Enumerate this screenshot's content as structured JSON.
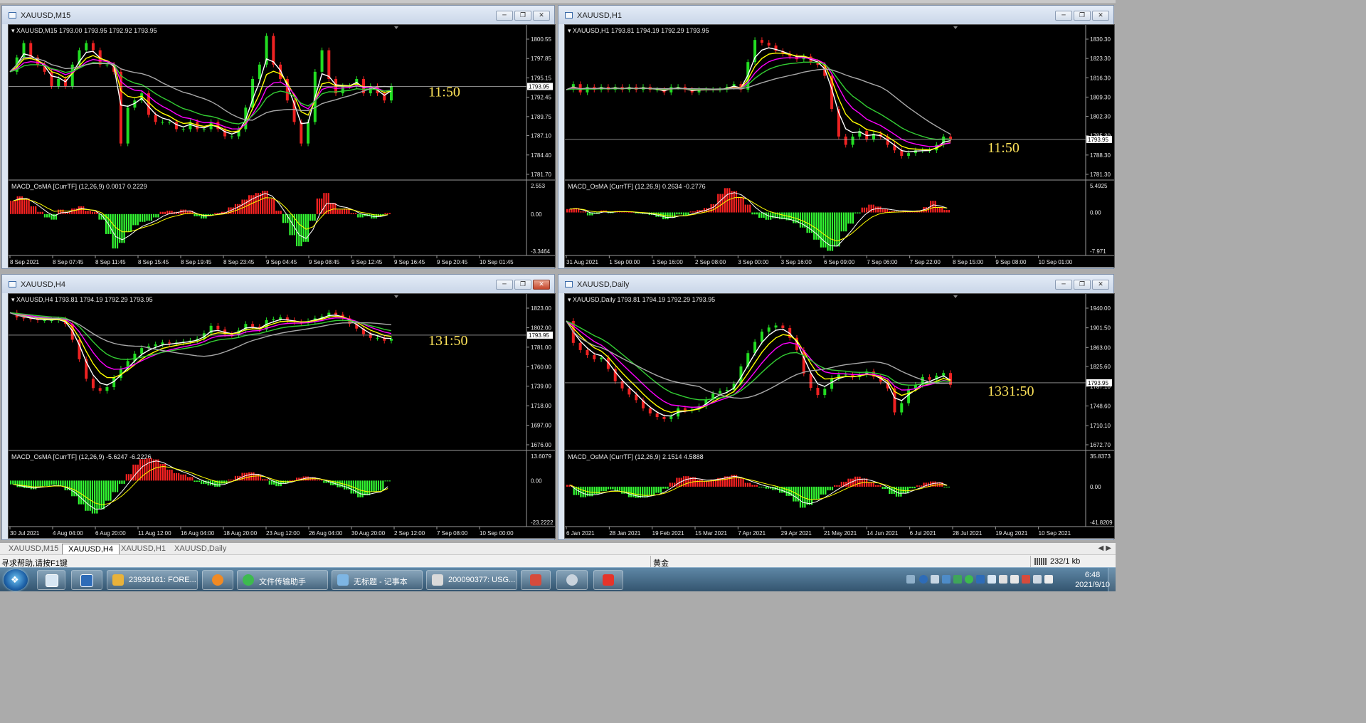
{
  "colors": {
    "price_line": "#D8D8D8",
    "ma_white": "#FFFFFF",
    "ma_yellow": "#FFFF00",
    "ma_magenta": "#FF00FF",
    "ma_green": "#33CC33",
    "ma_gray": "#A8A8A8",
    "hist_up": "#FF2222",
    "hist_down": "#33FF33",
    "timer": "#FFE45A",
    "text": "#E8E8E8"
  },
  "charts": [
    {
      "window_title": "XAUUSD,M15",
      "info": "XAUUSD,M15  1793.00 1793.95 1792.92 1793.95",
      "price_ticks": [
        "1800.55",
        "1797.85",
        "1795.15",
        "1792.45",
        "1789.75",
        "1787.10",
        "1784.40",
        "1781.70"
      ],
      "current_price": "1793.95",
      "timer": "11:50",
      "macd_label": "MACD_OsMA [CurrTF] (12,26,9) 0.0017 0.2229",
      "macd_ticks": [
        "2.553",
        "0.00",
        "-3.3464"
      ],
      "time_labels": [
        "8 Sep 2021",
        "8 Sep 07:45",
        "8 Sep 11:45",
        "8 Sep 15:45",
        "8 Sep 19:45",
        "8 Sep 23:45",
        "9 Sep 04:45",
        "9 Sep 08:45",
        "9 Sep 12:45",
        "9 Sep 16:45",
        "9 Sep 20:45",
        "10 Sep 01:45"
      ],
      "close_red": false
    },
    {
      "window_title": "XAUUSD,H1",
      "info": "XAUUSD,H1  1793.81 1794.19 1792.29 1793.95",
      "price_ticks": [
        "1830.30",
        "1823.30",
        "1816.30",
        "1809.30",
        "1802.30",
        "1795.30",
        "1788.30",
        "1781.30"
      ],
      "current_price": "1793.95",
      "timer": "11:50",
      "macd_label": "MACD_OsMA [CurrTF] (12,26,9) 0.2634 -0.2776",
      "macd_ticks": [
        "5.4925",
        "0.00",
        "-7.971"
      ],
      "time_labels": [
        "31 Aug 2021",
        "1 Sep 00:00",
        "1 Sep 16:00",
        "2 Sep 08:00",
        "3 Sep 00:00",
        "3 Sep 16:00",
        "6 Sep 09:00",
        "7 Sep 06:00",
        "7 Sep 22:00",
        "8 Sep 15:00",
        "9 Sep 08:00",
        "10 Sep 01:00"
      ],
      "close_red": false
    },
    {
      "window_title": "XAUUSD,H4",
      "info": "XAUUSD,H4  1793.81 1794.19 1792.29 1793.95",
      "price_ticks": [
        "1823.00",
        "1802.00",
        "1781.00",
        "1760.00",
        "1739.00",
        "1718.00",
        "1697.00",
        "1676.00"
      ],
      "current_price": "1793.95",
      "timer": "131:50",
      "macd_label": "MACD_OsMA [CurrTF] (12,26,9) -5.6247 -6.2226",
      "macd_ticks": [
        "13.6079",
        "0.00",
        "-23.2222"
      ],
      "time_labels": [
        "30 Jul 2021",
        "4 Aug 04:00",
        "6 Aug 20:00",
        "11 Aug 12:00",
        "16 Aug 04:00",
        "18 Aug 20:00",
        "23 Aug 12:00",
        "26 Aug 04:00",
        "30 Aug 20:00",
        "2 Sep 12:00",
        "7 Sep 08:00",
        "10 Sep 00:00"
      ],
      "close_red": true
    },
    {
      "window_title": "XAUUSD,Daily",
      "info": "XAUUSD,Daily  1793.81 1794.19 1792.29 1793.95",
      "price_ticks": [
        "1940.00",
        "1901.50",
        "1863.00",
        "1825.60",
        "1787.10",
        "1748.60",
        "1710.10",
        "1672.70"
      ],
      "current_price": "1793.95",
      "timer": "1331:50",
      "macd_label": "MACD_OsMA [CurrTF] (12,26,9) 2.1514 4.5888",
      "macd_ticks": [
        "35.8373",
        "0.00",
        "-41.8209"
      ],
      "time_labels": [
        "6 Jan 2021",
        "28 Jan 2021",
        "19 Feb 2021",
        "15 Mar 2021",
        "7 Apr 2021",
        "29 Apr 2021",
        "21 May 2021",
        "14 Jun 2021",
        "6 Jul 2021",
        "28 Jul 2021",
        "19 Aug 2021",
        "10 Sep 2021"
      ],
      "close_red": false
    }
  ],
  "chart_series": [
    {
      "price": [
        1796,
        1798,
        1800,
        1798,
        1797,
        1796,
        1794,
        1795,
        1794,
        1797,
        1799,
        1800,
        1799,
        1797,
        1797,
        1796,
        1786,
        1791,
        1792,
        1793,
        1790,
        1789,
        1789,
        1789,
        1788,
        1788,
        1789,
        1788,
        1788,
        1789,
        1788,
        1787,
        1787,
        1788,
        1791,
        1795,
        1797,
        1801,
        1797,
        1795,
        1792,
        1789,
        1786,
        1789,
        1796,
        1799,
        1795,
        1793,
        1794,
        1794,
        1795,
        1793,
        1794,
        1793,
        1792,
        1794
      ],
      "macd": [
        1.2,
        1.6,
        1.4,
        0.7,
        0.2,
        -0.3,
        -0.5,
        0.4,
        0.2,
        0.5,
        0.7,
        0.3,
        0.2,
        -0.5,
        -1.8,
        -3.1,
        -2.6,
        -1.6,
        -1.0,
        -0.7,
        -0.6,
        -0.3,
        0.2,
        0.3,
        0.2,
        0.4,
        0.3,
        -0.2,
        -0.4,
        -0.1,
        0.1,
        0.2,
        0.6,
        0.9,
        1.3,
        1.7,
        1.9,
        2.1,
        1.4,
        0.3,
        -0.8,
        -1.9,
        -2.9,
        -2.5,
        -0.6,
        1.4,
        1.9,
        1.0,
        0.4,
        0.5,
        0.1,
        -0.3,
        -0.2,
        -0.4,
        -0.2,
        0.1
      ]
    },
    {
      "price": [
        1812,
        1814,
        1811,
        1813,
        1812,
        1813,
        1812,
        1813,
        1812,
        1813,
        1812,
        1813,
        1812,
        1812,
        1811,
        1813,
        1813,
        1812,
        1811,
        1812,
        1812,
        1812,
        1812,
        1813,
        1814,
        1812,
        1822,
        1830,
        1829,
        1828,
        1826,
        1825,
        1824,
        1823,
        1824,
        1822,
        1821,
        1817,
        1805,
        1795,
        1792,
        1795,
        1797,
        1794,
        1796,
        1795,
        1792,
        1790,
        1788,
        1789,
        1790,
        1790,
        1790,
        1792,
        1795,
        1794
      ],
      "macd": [
        0.7,
        0.9,
        0.2,
        -0.6,
        -0.3,
        0.4,
        -0.1,
        0.3,
        0.2,
        0.1,
        -0.2,
        -0.3,
        -0.5,
        -0.9,
        -1.4,
        -1.1,
        -0.4,
        -0.6,
        0.2,
        0.5,
        0.9,
        1.7,
        3.8,
        5.0,
        4.4,
        3.2,
        1.6,
        -0.4,
        -1.1,
        -1.5,
        -1.2,
        -1.4,
        -1.6,
        -2.2,
        -3.1,
        -4.2,
        -5.6,
        -7.2,
        -7.9,
        -7.0,
        -3.9,
        -2.3,
        -0.2,
        1.0,
        1.6,
        1.2,
        0.7,
        0.3,
        0.2,
        0.3,
        0.2,
        0.4,
        1.1,
        2.4,
        1.1,
        0.5
      ]
    },
    {
      "price": [
        1818,
        1813,
        1812,
        1811,
        1810,
        1810,
        1810,
        1811,
        1806,
        1789,
        1768,
        1747,
        1737,
        1734,
        1738,
        1748,
        1758,
        1766,
        1774,
        1780,
        1782,
        1784,
        1786,
        1785,
        1786,
        1787,
        1788,
        1790,
        1796,
        1804,
        1800,
        1795,
        1794,
        1799,
        1806,
        1803,
        1800,
        1810,
        1811,
        1813,
        1810,
        1808,
        1807,
        1809,
        1812,
        1814,
        1818,
        1816,
        1812,
        1806,
        1801,
        1795,
        1791,
        1791,
        1788,
        1790
      ],
      "macd": [
        -2.1,
        -3.6,
        -4.2,
        -4.8,
        -3.2,
        -3.0,
        -2.3,
        -3.1,
        -5.4,
        -8.7,
        -13.2,
        -16.8,
        -18.3,
        -15.9,
        -11.2,
        -6.4,
        -1.8,
        3.6,
        8.9,
        11.9,
        12.4,
        11.8,
        9.3,
        6.1,
        4.2,
        3.4,
        2.0,
        -0.7,
        -1.9,
        -2.7,
        -3.4,
        -1.7,
        0.6,
        2.6,
        4.3,
        4.6,
        3.4,
        0.8,
        -2.2,
        -3.1,
        -1.6,
        0.2,
        1.6,
        2.3,
        1.9,
        0.4,
        -1.3,
        -2.6,
        -3.7,
        -4.9,
        -7.2,
        -9.3,
        -8.2,
        -6.1,
        -5.6,
        -0.4
      ]
    },
    {
      "price": [
        1915,
        1872,
        1858,
        1848,
        1840,
        1843,
        1821,
        1797,
        1783,
        1771,
        1760,
        1744,
        1734,
        1727,
        1723,
        1728,
        1744,
        1740,
        1742,
        1748,
        1761,
        1773,
        1778,
        1780,
        1792,
        1826,
        1852,
        1874,
        1894,
        1902,
        1906,
        1901,
        1882,
        1858,
        1812,
        1784,
        1770,
        1782,
        1803,
        1810,
        1810,
        1805,
        1810,
        1816,
        1806,
        1796,
        1783,
        1736,
        1754,
        1782,
        1790,
        1805,
        1800,
        1808,
        1813,
        1790
      ],
      "macd": [
        2.1,
        -9.8,
        -12.4,
        -11.2,
        -8.6,
        -5.2,
        -3.1,
        -4.6,
        -8.2,
        -12.3,
        -13.1,
        -12.7,
        -9.6,
        -7.2,
        -2.3,
        4.6,
        10.4,
        12.3,
        11.2,
        8.1,
        6.4,
        8.4,
        10.2,
        12.1,
        13.8,
        9.6,
        4.5,
        2.1,
        -0.7,
        -2.3,
        -3.9,
        -7.1,
        -10.8,
        -17.3,
        -24.6,
        -21.3,
        -14.9,
        -9.2,
        -4.3,
        1.6,
        5.8,
        9.4,
        11.8,
        9.6,
        5.2,
        1.8,
        -2.6,
        -8.4,
        -11.6,
        -7.9,
        -1.9,
        1.4,
        4.7,
        6.1,
        5.2,
        -0.8
      ]
    }
  ],
  "tabs": [
    "XAUUSD,M15",
    "XAUUSD,H4",
    "XAUUSD,H1",
    "XAUUSD,Daily"
  ],
  "active_tab": 1,
  "status": {
    "help": "寻求帮助,请按F1键",
    "symbol": "黄金",
    "traffic": "232/1 kb"
  },
  "taskbar": {
    "items": [
      {
        "label": "23939161: FORE...",
        "icon_color": "#E9B23A"
      },
      {
        "label": "",
        "icon_color": "#F08A24"
      },
      {
        "label": "文件传输助手",
        "icon_color": "#3DBA4E"
      },
      {
        "label": "无标题 - 记事本",
        "icon_color": "#7EB6E4"
      },
      {
        "label": "200090377: USG...",
        "icon_color": "#E9B23A"
      },
      {
        "label": "",
        "icon_color": "#D64B3C"
      },
      {
        "label": "",
        "icon_color": "#C9D3DD"
      },
      {
        "label": "",
        "icon_color": "#E5342A"
      }
    ],
    "time": "6:48",
    "date": "2021/9/10"
  }
}
